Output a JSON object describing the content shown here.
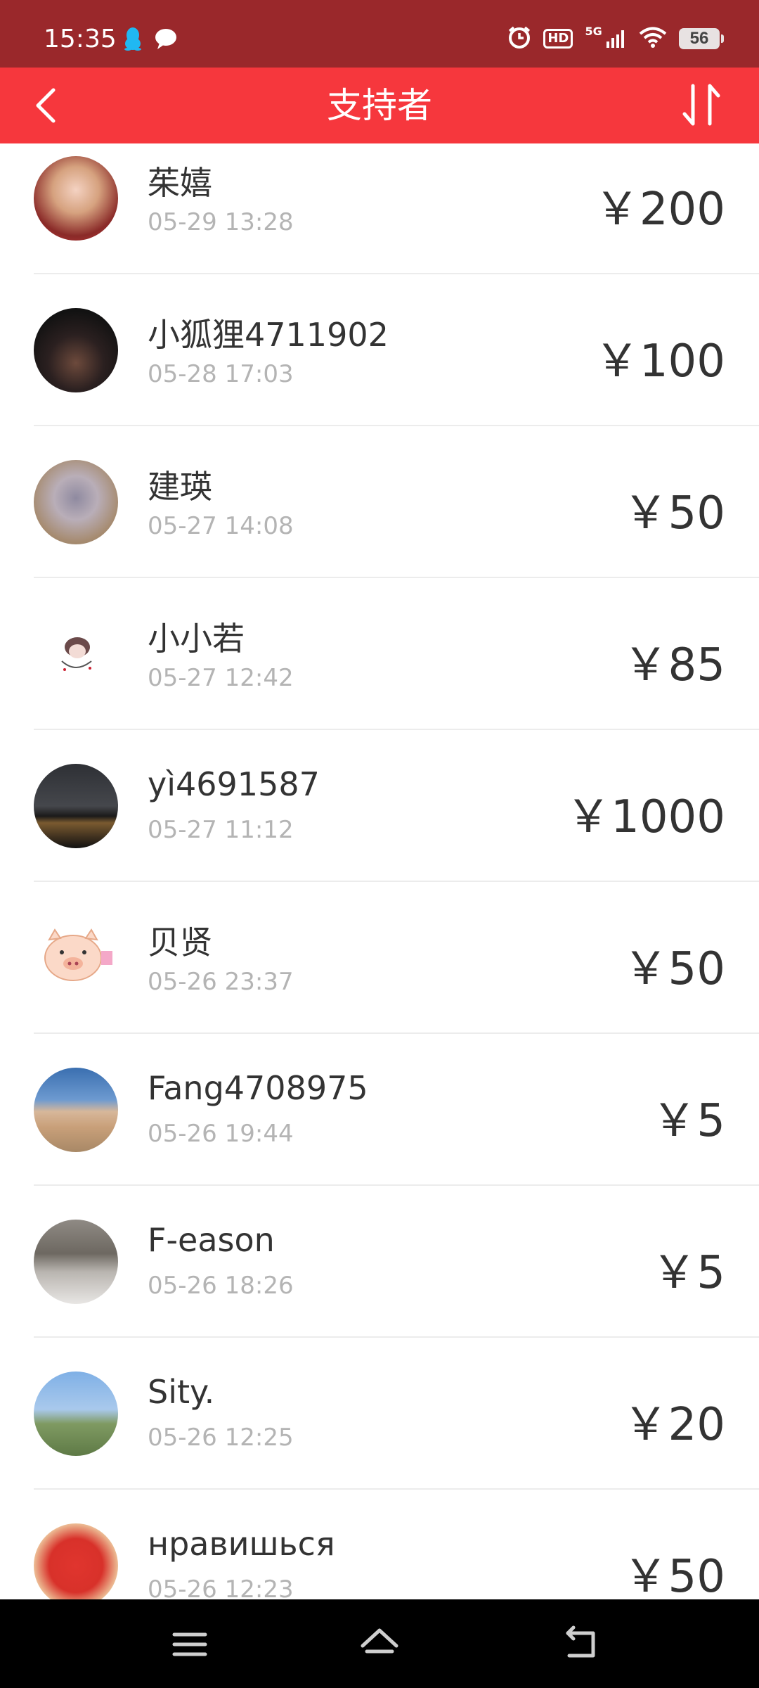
{
  "status_bar": {
    "time": "15:35",
    "battery": "56",
    "hd_label": "HD",
    "network_label": "5G",
    "left_icons": [
      "qq-penguin-icon",
      "chat-bubble-icon"
    ],
    "right_icons": [
      "alarm-icon",
      "hd-icon",
      "signal-5g-icon",
      "wifi-icon",
      "battery-icon"
    ]
  },
  "header": {
    "title": "支持者",
    "back_icon": "chevron-left-icon",
    "sort_icon": "sort-arrows-icon",
    "background": "#f6373d"
  },
  "supporters": [
    {
      "name": "茱嬉",
      "time": "05-29 13:28",
      "amount": "￥200"
    },
    {
      "name": "小狐狸4711902",
      "time": "05-28 17:03",
      "amount": "￥100"
    },
    {
      "name": "建瑛",
      "time": "05-27 14:08",
      "amount": "￥50"
    },
    {
      "name": "小小若",
      "time": "05-27 12:42",
      "amount": "￥85"
    },
    {
      "name": "yì4691587",
      "time": "05-27 11:12",
      "amount": "￥1000"
    },
    {
      "name": "贝贤",
      "time": "05-26 23:37",
      "amount": "￥50"
    },
    {
      "name": "Fang4708975",
      "time": "05-26 19:44",
      "amount": "￥5"
    },
    {
      "name": "F-eason",
      "time": "05-26 18:26",
      "amount": "￥5"
    },
    {
      "name": "Sity.",
      "time": "05-26 12:25",
      "amount": "￥20"
    },
    {
      "name": "нравишься",
      "time": "05-26 12:23",
      "amount": "￥50"
    }
  ],
  "system_nav": {
    "icons": [
      "menu-icon",
      "home-icon",
      "back-icon"
    ]
  }
}
